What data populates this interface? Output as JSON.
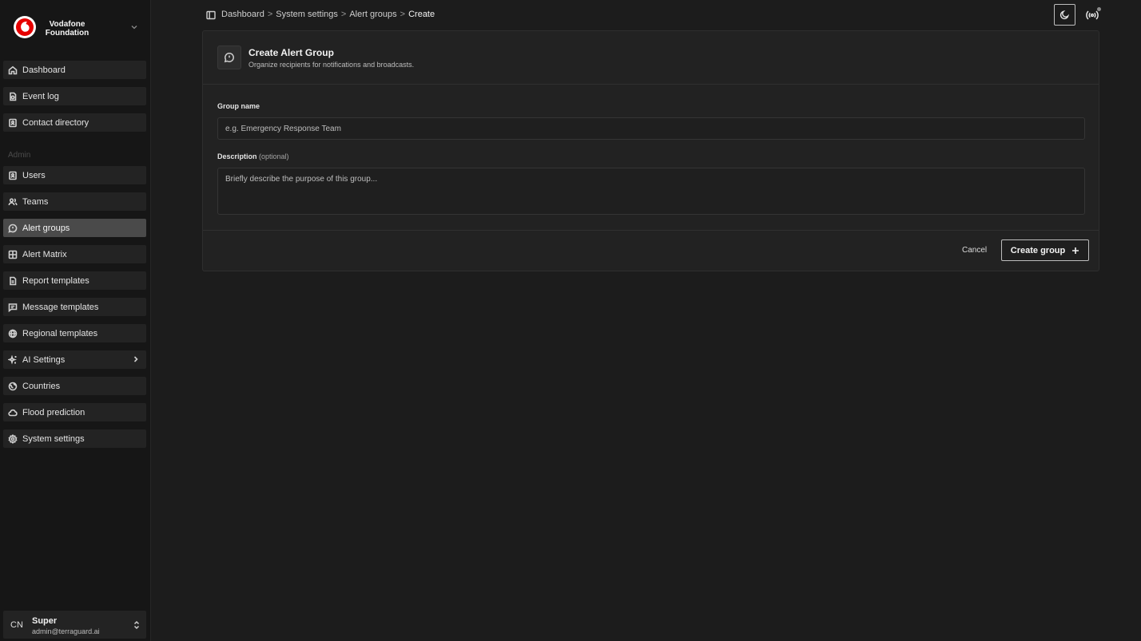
{
  "brand": {
    "name_line1": "Vodafone",
    "name_line2": "Foundation",
    "logo_icon": "vodafone-speechmark-icon",
    "accent_color": "#e60000"
  },
  "sidebar": {
    "main_items": [
      {
        "label": "Dashboard",
        "icon": "home-icon"
      },
      {
        "label": "Event log",
        "icon": "event-log-icon"
      },
      {
        "label": "Contact directory",
        "icon": "contact-book-icon"
      }
    ],
    "section_label": "Admin",
    "admin_items": [
      {
        "label": "Users",
        "icon": "user-book-icon"
      },
      {
        "label": "Teams",
        "icon": "users-icon"
      },
      {
        "label": "Alert groups",
        "icon": "message-alert-icon",
        "active": true
      },
      {
        "label": "Alert Matrix",
        "icon": "grid-icon"
      },
      {
        "label": "Report templates",
        "icon": "file-report-icon"
      },
      {
        "label": "Message templates",
        "icon": "message-square-icon"
      },
      {
        "label": "Regional templates",
        "icon": "globe-icon"
      },
      {
        "label": "AI Settings",
        "icon": "sparkles-icon",
        "has_submenu": true
      },
      {
        "label": "Countries",
        "icon": "earth-icon"
      },
      {
        "label": "Flood prediction",
        "icon": "cloud-icon"
      },
      {
        "label": "System settings",
        "icon": "gear-icon"
      }
    ],
    "user": {
      "initials": "CN",
      "name": "Super",
      "email": "admin@terraguard.ai"
    }
  },
  "topbar": {
    "breadcrumb": [
      "Dashboard",
      "System settings",
      "Alert groups",
      "Create"
    ],
    "separator": ">"
  },
  "card": {
    "title": "Create Alert Group",
    "subtitle": "Organize recipients for notifications and broadcasts.",
    "group_name": {
      "label": "Group name",
      "value": "",
      "placeholder": "e.g. Emergency Response Team"
    },
    "description": {
      "label": "Description",
      "optional_note": "(optional)",
      "value": "",
      "placeholder": "Briefly describe the purpose of this group..."
    },
    "cancel_label": "Cancel",
    "submit_label": "Create group"
  }
}
